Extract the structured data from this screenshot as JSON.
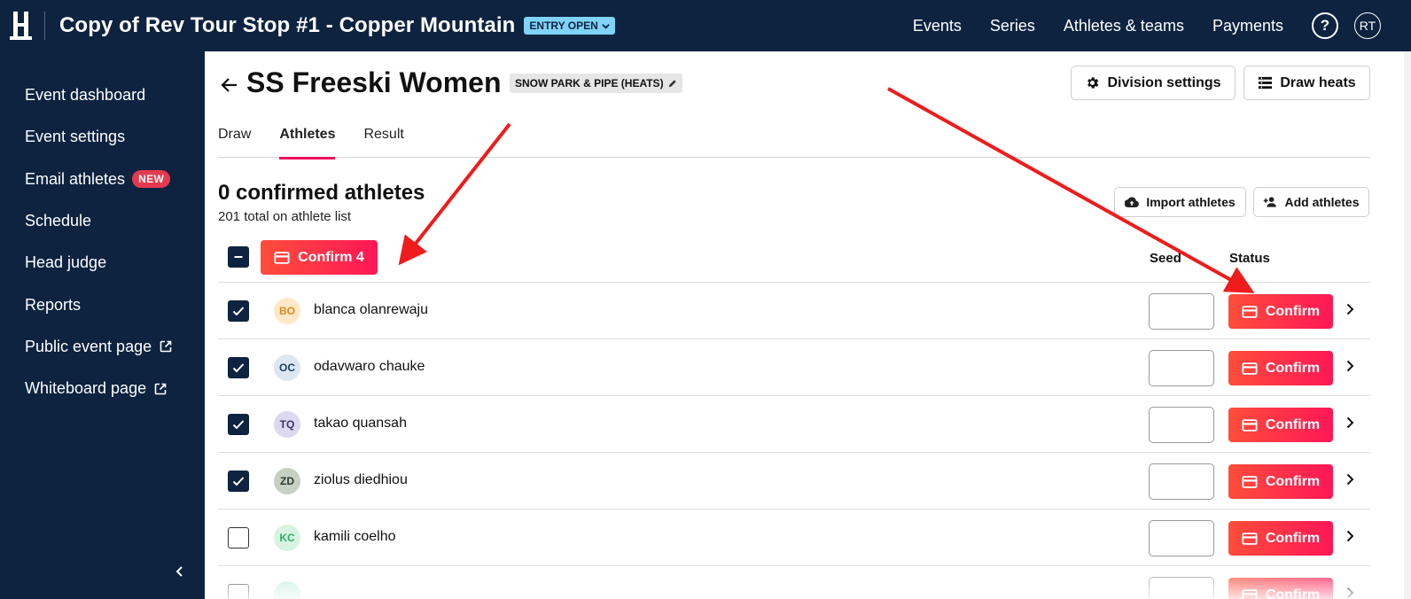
{
  "topbar": {
    "event_title": "Copy of Rev Tour Stop #1 - Copper Mountain",
    "status": "ENTRY OPEN",
    "nav": [
      "Events",
      "Series",
      "Athletes & teams",
      "Payments"
    ],
    "help": "?",
    "user_initials": "RT"
  },
  "sidebar": {
    "items": [
      {
        "label": "Event dashboard"
      },
      {
        "label": "Event settings"
      },
      {
        "label": "Email athletes",
        "badge": "NEW"
      },
      {
        "label": "Schedule"
      },
      {
        "label": "Head judge"
      },
      {
        "label": "Reports"
      },
      {
        "label": "Public event page"
      },
      {
        "label": "Whiteboard page"
      }
    ]
  },
  "division": {
    "title": "SS Freeski Women",
    "discipline": "SNOW PARK & PIPE (HEATS)",
    "settings_button": "Division settings",
    "draw_button": "Draw heats"
  },
  "tabs": [
    {
      "label": "Draw"
    },
    {
      "label": "Athletes"
    },
    {
      "label": "Result"
    }
  ],
  "athletes": {
    "confirmed_count": "0 confirmed athletes",
    "total_text": "201 total on athlete list",
    "import_button": "Import athletes",
    "add_button": "Add athletes",
    "bulk_confirm": "Confirm 4",
    "col_seed": "Seed",
    "col_status": "Status",
    "confirm_label": "Confirm",
    "rows": [
      {
        "initials": "BO",
        "name": "blanca olanrewaju",
        "checked": true,
        "avatar_bg": "#fde8c8",
        "avatar_fg": "#e08a1e"
      },
      {
        "initials": "OC",
        "name": "odavwaro chauke",
        "checked": true,
        "avatar_bg": "#dde6f3",
        "avatar_fg": "#1f3f6e"
      },
      {
        "initials": "TQ",
        "name": "takao quansah",
        "checked": true,
        "avatar_bg": "#dcd8ef",
        "avatar_fg": "#3b3470"
      },
      {
        "initials": "ZD",
        "name": "ziolus diedhiou",
        "checked": true,
        "avatar_bg": "#c8cfc4",
        "avatar_fg": "#2c3a2a"
      },
      {
        "initials": "KC",
        "name": "kamili coelho",
        "checked": false,
        "avatar_bg": "#d8f3e2",
        "avatar_fg": "#2fae62"
      },
      {
        "initials": "",
        "name": "",
        "checked": false,
        "avatar_bg": "#c6ece0",
        "avatar_fg": "#2fae82"
      }
    ]
  },
  "colors": {
    "navy": "#0d2340",
    "accent": "#ff1757",
    "status_pill": "#7fd3f6",
    "annotation_arrow": "#ee1c1c"
  }
}
